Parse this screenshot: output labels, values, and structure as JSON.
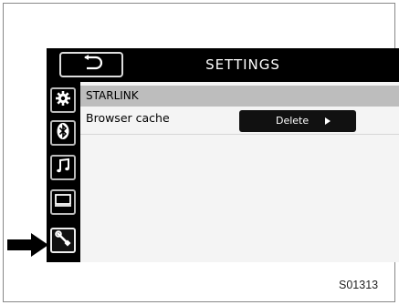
{
  "header": {
    "title": "SETTINGS",
    "back_icon": "return-arrow-icon"
  },
  "sidebar": {
    "items": [
      {
        "name": "settings",
        "icon": "gear-icon",
        "active": false
      },
      {
        "name": "bluetooth",
        "icon": "bluetooth-icon",
        "active": false
      },
      {
        "name": "audio",
        "icon": "music-note-icon",
        "active": false
      },
      {
        "name": "display",
        "icon": "screen-icon",
        "active": false
      },
      {
        "name": "tools",
        "icon": "wrench-icon",
        "active": true
      }
    ]
  },
  "main": {
    "section_title": "STARLINK",
    "rows": [
      {
        "label": "Browser cache",
        "button_label": "Delete"
      }
    ]
  },
  "figure": {
    "code": "S01313"
  }
}
